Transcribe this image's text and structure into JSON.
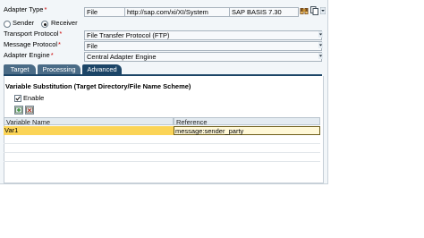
{
  "form": {
    "adapter_type": {
      "label": "Adapter Type",
      "required_mark": "*",
      "value": "File",
      "namespace": "http://sap.com/xi/XI/System",
      "software_component": "SAP BASIS 7.30"
    },
    "direction": {
      "sender_label": "Sender",
      "receiver_label": "Receiver",
      "selected": "Receiver"
    },
    "transport_protocol": {
      "label": "Transport Protocol",
      "required_mark": "*",
      "value": "File Transfer Protocol (FTP)"
    },
    "message_protocol": {
      "label": "Message Protocol",
      "required_mark": "*",
      "value": "File"
    },
    "adapter_engine": {
      "label": "Adapter Engine",
      "required_mark": "*",
      "value": "Central Adapter Engine"
    }
  },
  "tabs": [
    {
      "label": "Target"
    },
    {
      "label": "Processing"
    },
    {
      "label": "Advanced"
    }
  ],
  "active_tab": "Advanced",
  "group": {
    "title": "Variable Substitution (Target Directory/File Name Scheme)",
    "enable_label": "Enable",
    "enable_checked": true
  },
  "table": {
    "columns": [
      "Variable Name",
      "Reference"
    ],
    "rows": [
      {
        "name": "Var1",
        "reference": "message:sender_party"
      }
    ]
  },
  "icons": {
    "adapter_browse": "binoculars-icon",
    "adapter_copy": "copy-icon",
    "adapter_dropdown": "dropdown-icon",
    "insert_row": "insert-row-icon",
    "delete_row": "delete-row-icon"
  },
  "colors": {
    "active_tab": "#1c4567",
    "inactive_tab": "#4a6b86",
    "selected_row": "#fbd457",
    "required": "#cc0000"
  }
}
